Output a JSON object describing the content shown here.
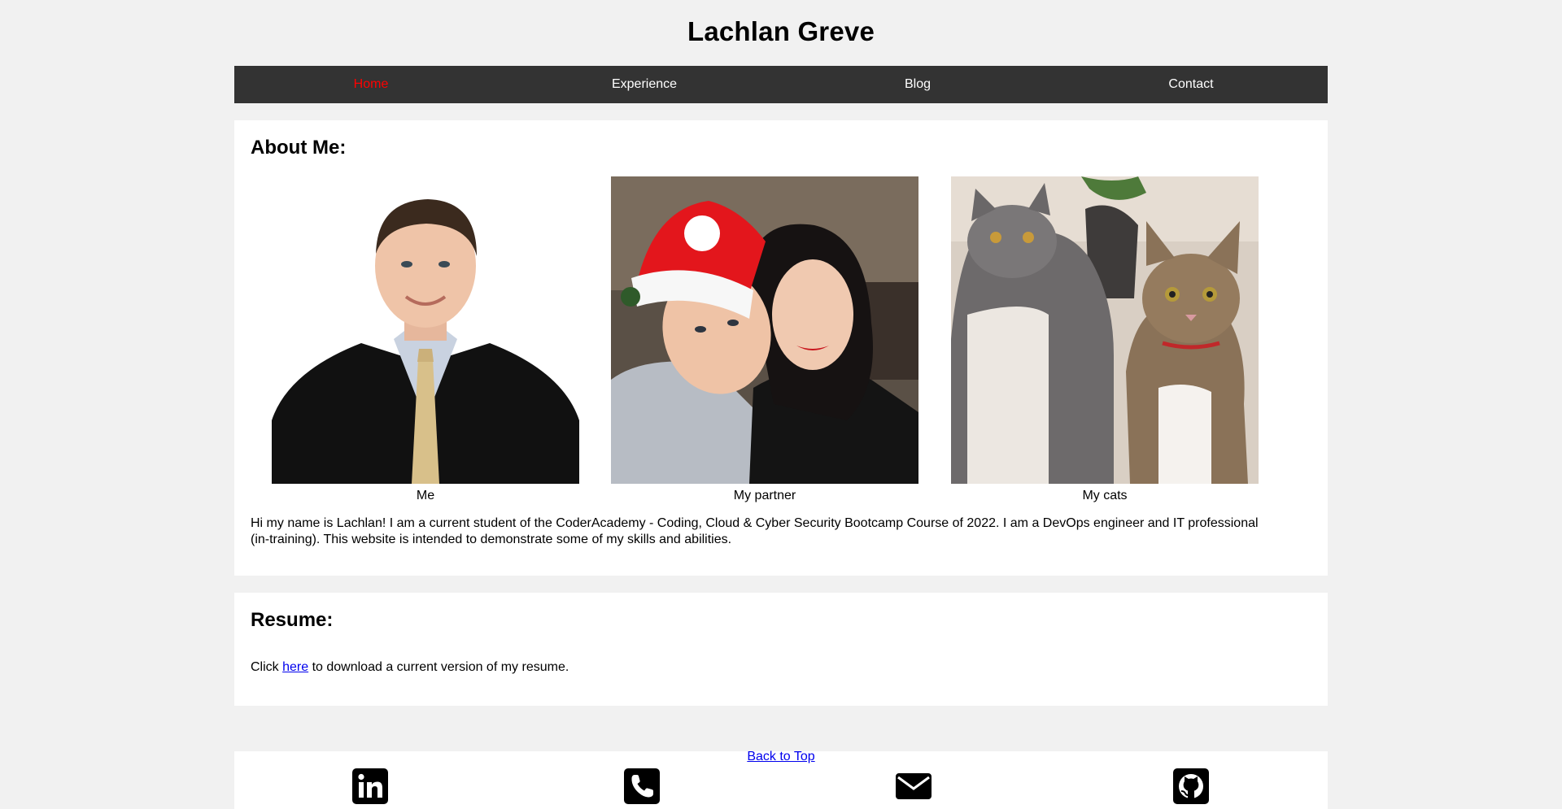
{
  "header": {
    "title": "Lachlan Greve"
  },
  "nav": {
    "items": [
      {
        "label": "Home",
        "active": true
      },
      {
        "label": "Experience",
        "active": false
      },
      {
        "label": "Blog",
        "active": false
      },
      {
        "label": "Contact",
        "active": false
      }
    ]
  },
  "about": {
    "heading": "About Me:",
    "photos": [
      {
        "caption": "Me",
        "alt": "Me"
      },
      {
        "caption": "My partner",
        "alt": "My partner"
      },
      {
        "caption": "My cats",
        "alt": "My cats"
      }
    ],
    "text": "Hi my name is Lachlan! I am a current student of the CoderAcademy - Coding, Cloud & Cyber Security Bootcamp Course of 2022. I am a DevOps engineer and IT professional (in-training). This website is intended to demonstrate some of my skills and abilities."
  },
  "resume": {
    "heading": "Resume:",
    "prefix": "Click ",
    "link": "here",
    "suffix": " to download a current version of my resume."
  },
  "footer": {
    "back_to_top": "Back to Top",
    "icons": [
      "linkedin-icon",
      "phone-icon",
      "email-icon",
      "github-icon"
    ]
  },
  "colors": {
    "page_bg": "#f1f1f1",
    "nav_bg": "#333333",
    "nav_active": "#ff0000",
    "link": "#0000ee"
  }
}
